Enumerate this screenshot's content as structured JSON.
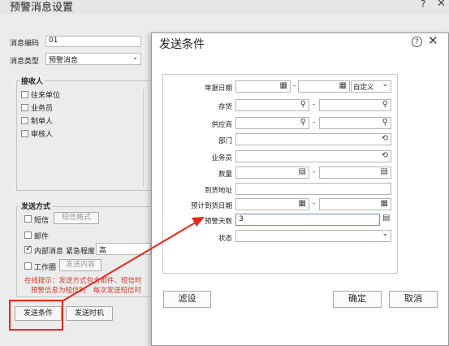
{
  "bg_window": {
    "title": "预警消息设置",
    "msg_code_label": "消息编码",
    "msg_code_value": "01",
    "msg_type_label": "消息类型",
    "msg_type_value": "预警消息",
    "receivers_title": "接收人",
    "receivers": [
      "往来单位",
      "业务员",
      "制单人",
      "审核人"
    ],
    "send_method_title": "发送方式",
    "sms_label": "短信",
    "sms_format_btn": "短信格式",
    "mail_label": "邮件",
    "internal_label": "内部消息",
    "urgency_label": "紧急程度",
    "urgency_value": "高",
    "work_circle_label": "工作圈",
    "send_content_btn": "发送内容",
    "tip_line1": "在线提示：发送方式包含邮件、短信时",
    "tip_line2": "预警信息为短信时　每次发送短信时",
    "send_condition_btn": "发送条件",
    "send_time_btn": "发送时机"
  },
  "dialog": {
    "title": "发送条件",
    "help_glyph": "?",
    "close_glyph": "✕",
    "fields": {
      "doc_date": "单据日期",
      "inventory": "存货",
      "supplier": "供应商",
      "department": "部门",
      "salesperson": "业务员",
      "quantity": "数量",
      "arrival_address": "到货地址",
      "expected_arrival_date": "预计到货日期",
      "warning_days": "预警天数",
      "status": "状态"
    },
    "date_range_mode": "自定义",
    "range_dash": "-",
    "warning_days_value": "3",
    "filter_btn": "滤设",
    "ok_btn": "确定",
    "cancel_btn": "取消"
  },
  "colors": {
    "annotation_red": "#e8271c"
  }
}
